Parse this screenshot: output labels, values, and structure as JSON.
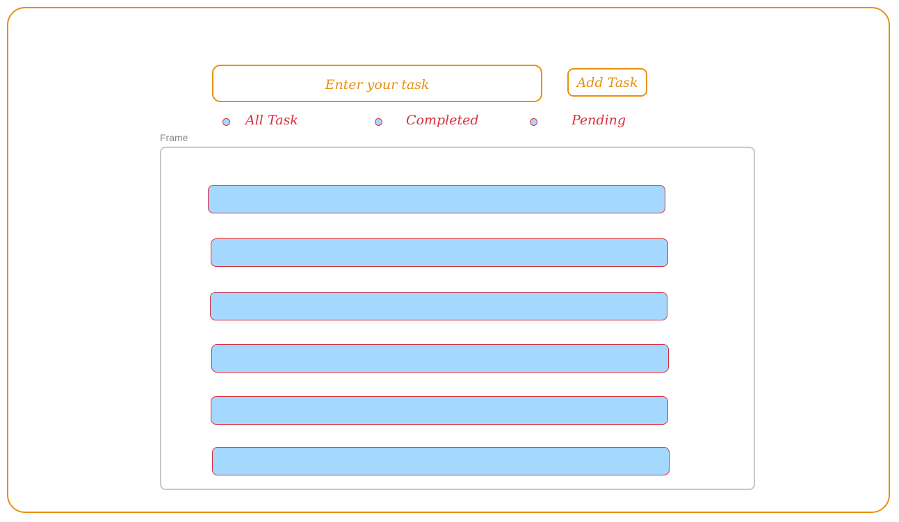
{
  "input": {
    "placeholder": "Enter your task"
  },
  "toolbar": {
    "add_label": "Add Task"
  },
  "filters": [
    {
      "label": "All Task"
    },
    {
      "label": "Completed"
    },
    {
      "label": "Pending"
    }
  ],
  "frame": {
    "label": "Frame"
  },
  "task_count": 6,
  "colors": {
    "accent_orange": "#e8900c",
    "accent_red": "#d92e3c",
    "task_fill": "#a5d8ff",
    "frame_border": "#c8c8cc"
  }
}
